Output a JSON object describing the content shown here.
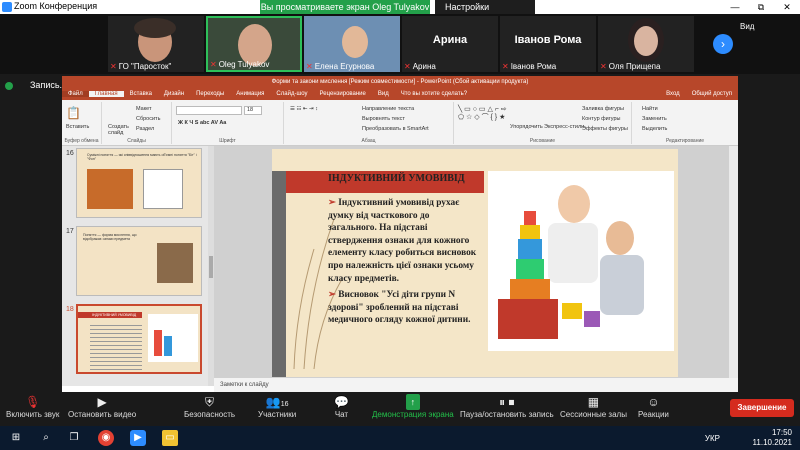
{
  "zoom": {
    "title": "Zoom Конференция",
    "sharing_banner": "Вы просматриваете экран Oleg Tulyakov",
    "view_options": "Настройки просмотра",
    "view_label": "Вид",
    "recording_label": "Запись...",
    "win_min": "—",
    "win_max": "⧉",
    "win_close": "✕"
  },
  "participants": [
    {
      "name": "ГО \"Паросток\"",
      "muted": true
    },
    {
      "name": "Oleg Tulyakov",
      "muted": true
    },
    {
      "name": "Елена Егурнова",
      "muted": true
    },
    {
      "name": "Арина",
      "muted": true,
      "display": "Арина"
    },
    {
      "name": "Іванов  Рома",
      "muted": true,
      "display": "Іванов  Рома"
    },
    {
      "name": "Оля Прищепа",
      "muted": true
    }
  ],
  "ppt": {
    "title": "Форми та закони мислення [Режим совместимости] - PowerPoint (Сбой активации продукта)",
    "tabs": [
      "Файл",
      "Главная",
      "Вставка",
      "Дизайн",
      "Переходы",
      "Анимация",
      "Слайд-шоу",
      "Рецензирование",
      "Вид",
      "Что вы хотите сделать?"
    ],
    "right_tabs": [
      "Вход",
      "Общий доступ"
    ],
    "ribbon": {
      "paste": "Вставить",
      "create": "Создать слайд",
      "layout": "Макет",
      "reset": "Сбросить",
      "section": "Раздел",
      "clipboard": "Буфер обмена",
      "slides": "Слайды",
      "font": "Шрифт",
      "font_size": "18",
      "paragraph": "Абзац",
      "text_dir": "Направление текста",
      "align_text": "Выровнять текст",
      "smartart": "Преобразовать в SmartArt",
      "drawing": "Рисование",
      "arrange": "Упорядочить",
      "quick_styles": "Экспресс-стили",
      "fill": "Заливка фигуры",
      "outline": "Контур фигуры",
      "effects": "Эффекты фигуры",
      "find": "Найти",
      "replace": "Заменить",
      "select": "Выделить",
      "editing": "Редактирование"
    },
    "thumbs": [
      {
        "num": "16",
        "text": "Суміжні поняття — які співвідношення мають об'ємні поняття \"Біт\" і \"Фон\""
      },
      {
        "num": "17",
        "text": "Поняття — форма мислення, що відображає ознаки предмета"
      },
      {
        "num": "18",
        "text": "ІНДУКТИВНИЙ УМОВИВІД"
      }
    ],
    "slide": {
      "title": "ІНДУКТИВНИЙ УМОВИВІД",
      "bullets": [
        "Індуктивний умовивід рухає думку від часткового до загального. На підставі ствердження ознаки для кожного елементу класу робиться висновок про належність цієї ознаки усьому класу предметів.",
        "Висновок \"Усі діти групи N здорові\" зроблений на підставі медичного огляду кожної дитини."
      ]
    },
    "notes": "Заметки к слайду"
  },
  "toolbar": {
    "mic": "Включить звук",
    "video": "Остановить видео",
    "security": "Безопасность",
    "participants": "Участники",
    "participants_count": "16",
    "chat": "Чат",
    "share": "Демонстрация экрана",
    "record": "Пауза/остановить запись",
    "breakout": "Сессионные залы",
    "reactions": "Реакции",
    "end": "Завершение"
  },
  "taskbar": {
    "lang": "УКР",
    "time": "17:50",
    "date": "11.10.2021"
  },
  "colors": {
    "zoom_blue": "#2d8cff",
    "share_green": "#23a04a",
    "ppt_red": "#b7472a",
    "end_red": "#d52b1e"
  }
}
